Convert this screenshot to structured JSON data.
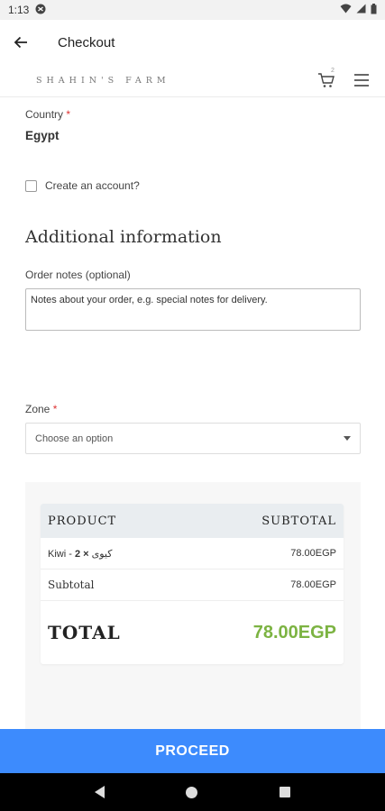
{
  "status_bar": {
    "time": "1:13"
  },
  "app_bar": {
    "title": "Checkout"
  },
  "site_header": {
    "brand": "SHAHIN'S FARM",
    "cart_count": "2"
  },
  "form": {
    "country_label": "Country",
    "required_mark": "*",
    "country_value": "Egypt",
    "create_account_label": "Create an account?",
    "create_account_checked": false,
    "section_title": "Additional information",
    "order_notes_label": "Order notes (optional)",
    "order_notes_placeholder": "Notes about your order, e.g. special notes for delivery.",
    "zone_label": "Zone",
    "zone_placeholder": "Choose an option"
  },
  "summary": {
    "col_product": "PRODUCT",
    "col_subtotal": "SUBTOTAL",
    "item_name": "Kiwi - كيوى",
    "item_qty": "× 2",
    "item_subtotal": "78.00EGP",
    "subtotal_label": "Subtotal",
    "subtotal_value": "78.00EGP",
    "total_label": "TOTAL",
    "total_value": "78.00EGP"
  },
  "footer": {
    "proceed_label": "PROCEED"
  },
  "colors": {
    "primary": "#3d8bfd",
    "total_green": "#7cb342",
    "required_red": "#d33333"
  }
}
